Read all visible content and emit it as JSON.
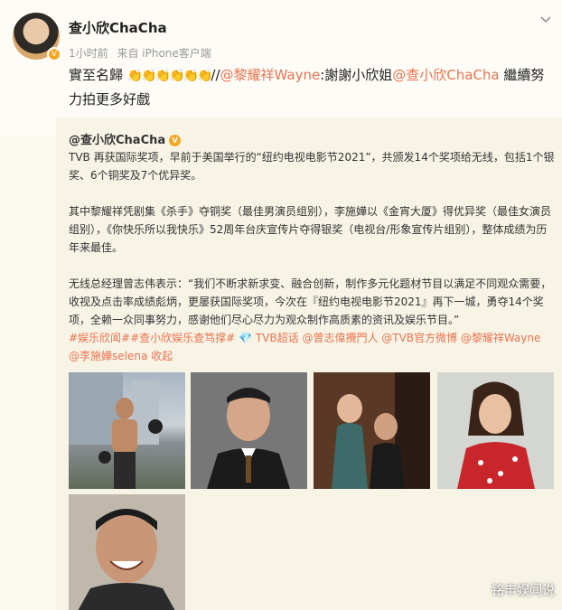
{
  "post": {
    "username": "查小欣ChaCha",
    "time": "1小时前",
    "source": "来自 iPhone客户端",
    "text_prefix": "實至名歸",
    "claps": "👏👏👏👏👏👏",
    "sep": "//",
    "mention1": "@黎耀祥Wayne",
    "mid": ":謝謝小欣姐",
    "mention2": "@查小欣ChaCha",
    "suffix": " 繼續努力拍更多好戲"
  },
  "repost": {
    "username": "@查小欣ChaCha",
    "badge": "V",
    "para1": "TVB 再获国际奖项，早前于美国举行的“纽约电视电影节2021”，共颁发14个奖项给无线，包括1个银奖、6个铜奖及7个优异奖。",
    "para2": "其中黎耀祥凭剧集《杀手》夺铜奖（最佳男演员组别），李施嬅以《金宵大厦》得优异奖（最佳女演员组别），《你快乐所以我快乐》52周年台庆宣传片夺得银奖（电视台/形象宣传片组别），整体成绩为历年来最佳。",
    "para3": "无线总经理曾志伟表示：“我们不断求新求变、融合创新，制作多元化题材节目以满足不同观众需要，收视及点击率成绩彪炳，更屡获国际奖项，今次在『纽约电视电影节2021』再下一城，勇夺14个奖项，全赖一众同事努力，感谢他们尽心尽力为观众制作高质素的资讯及娱乐节目。”",
    "tags": "#娱乐欣闻##查小欣娱乐查笃撑#",
    "tag_super": "TVB超话",
    "mentions": "@曾志偉攪門人 @TVB官方微博 @黎耀祥Wayne @李施嬅selena",
    "collapse": "收起"
  },
  "watermark": "铭丰娱闻说",
  "colors": {
    "link": "#eb7350",
    "badge": "#f5a623"
  }
}
